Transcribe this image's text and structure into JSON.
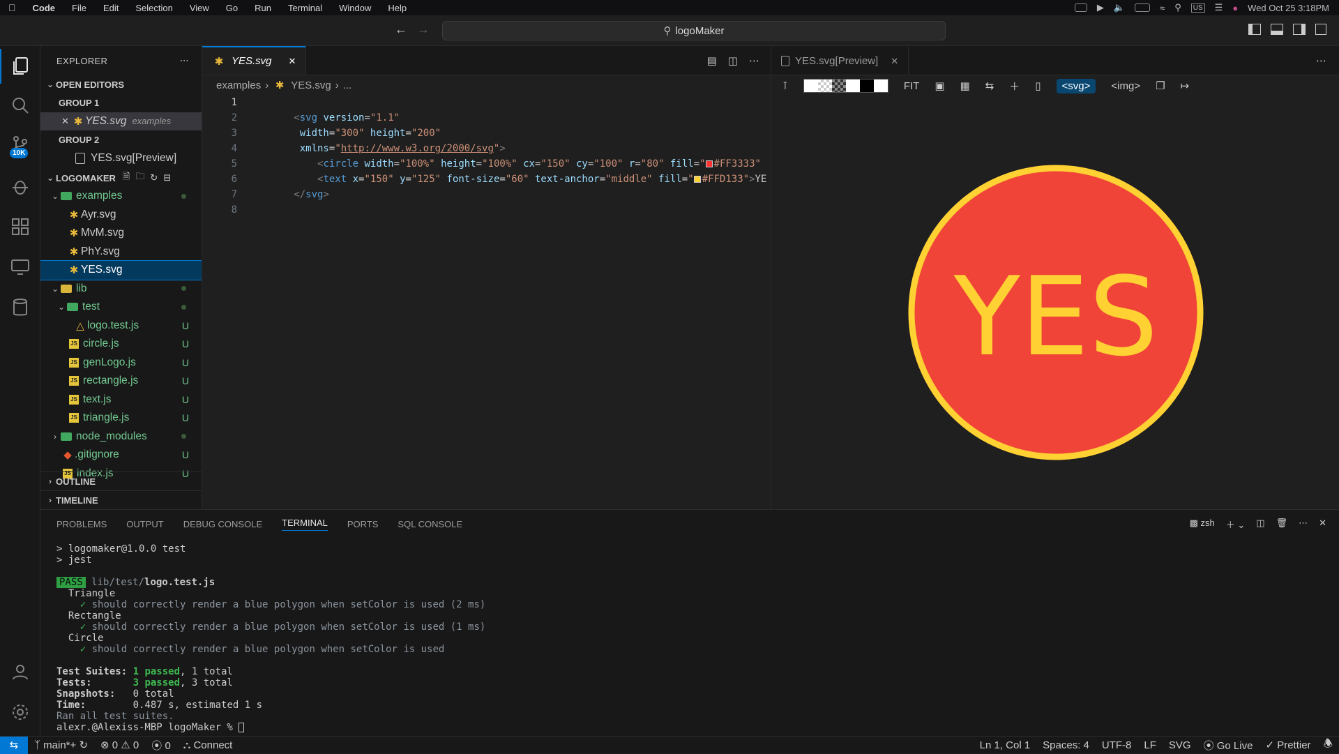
{
  "menubar": {
    "app": "Code",
    "items": [
      "File",
      "Edit",
      "Selection",
      "View",
      "Go",
      "Run",
      "Terminal",
      "Window",
      "Help"
    ],
    "clock": "Wed Oct 25  3:18PM",
    "input_source": "US"
  },
  "command_center": {
    "text": "logoMaker"
  },
  "activity": {
    "scm_badge": "10K"
  },
  "explorer": {
    "title": "EXPLORER",
    "open_editors": "OPEN EDITORS",
    "group1": "GROUP 1",
    "group1_file": "YES.svg",
    "group1_desc": "examples",
    "group2": "GROUP 2",
    "group2_file": "YES.svg[Preview]",
    "project": "LOGOMAKER",
    "tree": [
      {
        "name": "examples",
        "kind": "folder-open",
        "depth": 1,
        "status": "dot"
      },
      {
        "name": "Ayr.svg",
        "kind": "svg",
        "depth": 2
      },
      {
        "name": "MvM.svg",
        "kind": "svg",
        "depth": 2
      },
      {
        "name": "PhY.svg",
        "kind": "svg",
        "depth": 2
      },
      {
        "name": "YES.svg",
        "kind": "svg",
        "depth": 2,
        "selected": true
      },
      {
        "name": "lib",
        "kind": "folder-open",
        "depth": 1,
        "status": "dot"
      },
      {
        "name": "test",
        "kind": "folder-open",
        "depth": 2,
        "status": "dot"
      },
      {
        "name": "logo.test.js",
        "kind": "test",
        "depth": 3,
        "status": "U"
      },
      {
        "name": "circle.js",
        "kind": "js",
        "depth": 2,
        "status": "U"
      },
      {
        "name": "genLogo.js",
        "kind": "js",
        "depth": 2,
        "status": "U"
      },
      {
        "name": "rectangle.js",
        "kind": "js",
        "depth": 2,
        "status": "U"
      },
      {
        "name": "text.js",
        "kind": "js",
        "depth": 2,
        "status": "U"
      },
      {
        "name": "triangle.js",
        "kind": "js",
        "depth": 2,
        "status": "U"
      },
      {
        "name": "node_modules",
        "kind": "folder",
        "depth": 1,
        "status": "dot"
      },
      {
        "name": ".gitignore",
        "kind": "git",
        "depth": 1,
        "status": "U"
      },
      {
        "name": "index.js",
        "kind": "js",
        "depth": 1,
        "status": "U"
      }
    ],
    "outline": "OUTLINE",
    "timeline": "TIMELINE"
  },
  "editor": {
    "tab": "YES.svg",
    "breadcrumb": [
      "examples",
      "YES.svg",
      "..."
    ],
    "line_numbers": [
      "1",
      "2",
      "3",
      "4",
      "5",
      "6",
      "7",
      "8"
    ]
  },
  "preview": {
    "tab": "YES.svg[Preview]",
    "fit": "FIT",
    "svg_btn": "<svg>",
    "img_btn": "<img>",
    "logo_text": "YES",
    "circle_fill": "#F04438",
    "stroke": "#FFD133",
    "text_fill": "#FFD133"
  },
  "panel": {
    "tabs": [
      "PROBLEMS",
      "OUTPUT",
      "DEBUG CONSOLE",
      "TERMINAL",
      "PORTS",
      "SQL CONSOLE"
    ],
    "active_tab": "TERMINAL",
    "shell": "zsh"
  },
  "terminal": {
    "l1": "> logomaker@1.0.0 test",
    "l2": "> jest",
    "pass": "PASS",
    "path_dim": "lib/test/",
    "path_file": "logo.test.js",
    "t1": "Triangle",
    "t1c": "should correctly render a blue polygon when setColor is used (2 ms)",
    "t2": "Rectangle",
    "t2c": "should correctly render a blue polygon when setColor is used (1 ms)",
    "t3": "Circle",
    "t3c": "should correctly render a blue polygon when setColor is used",
    "suites_label": "Test Suites:",
    "suites_pass": "1 passed",
    "suites_total": ", 1 total",
    "tests_label": "Tests:",
    "tests_pass": "3 passed",
    "tests_total": ", 3 total",
    "snap_label": "Snapshots:",
    "snap_val": "0 total",
    "time_label": "Time:",
    "time_val": "0.487 s, estimated 1 s",
    "ran": "Ran all test suites.",
    "prompt": "alexr.@Alexiss-MBP logoMaker % "
  },
  "status": {
    "branch": "main*+",
    "errors": "0",
    "warnings": "0",
    "ports": "0",
    "connect": "Connect",
    "position": "Ln 1, Col 1",
    "spaces": "Spaces: 4",
    "encoding": "UTF-8",
    "eol": "LF",
    "lang": "SVG",
    "golive": "Go Live",
    "prettier": "Prettier"
  }
}
